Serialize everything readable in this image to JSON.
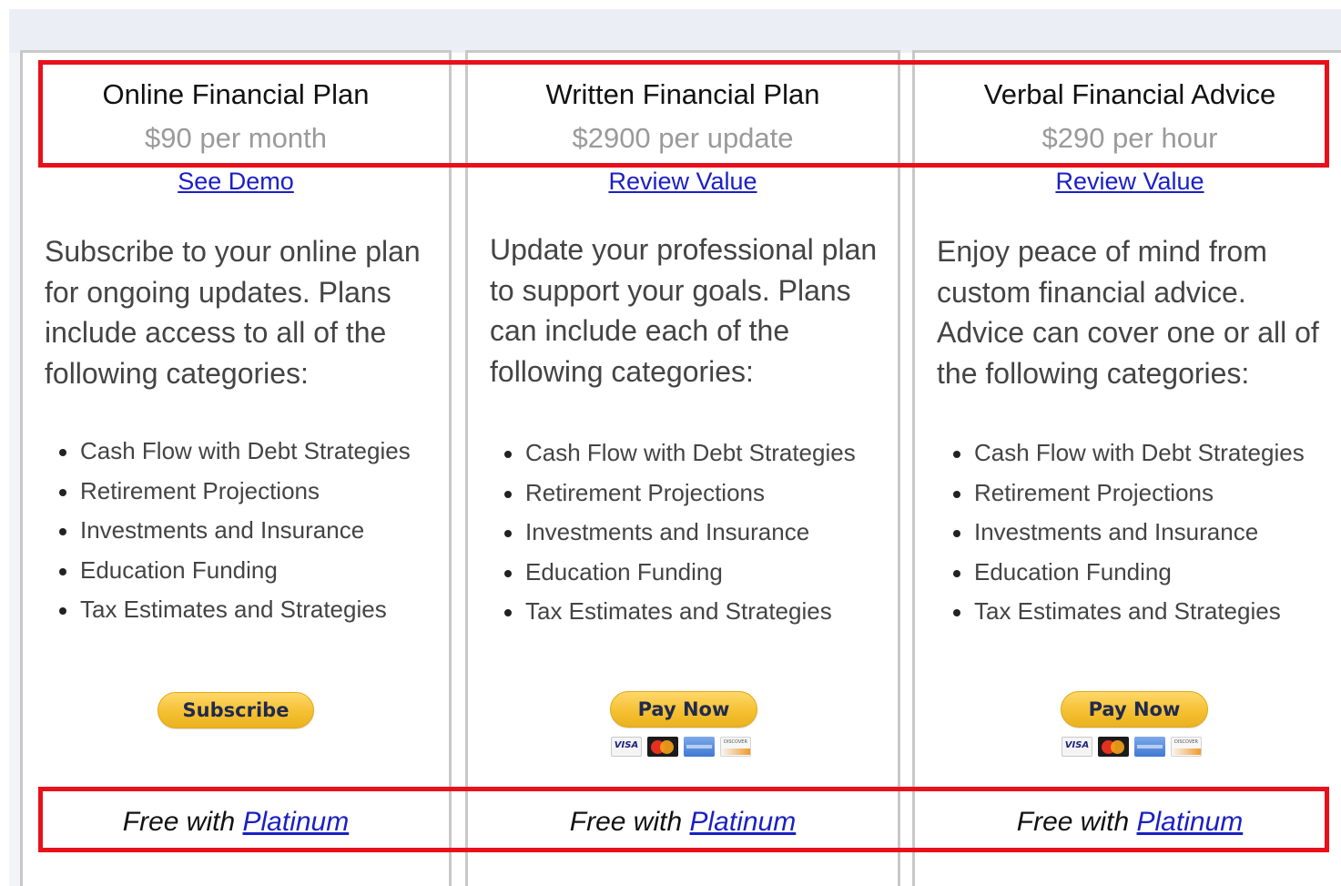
{
  "plans": [
    {
      "title": "Online Financial Plan",
      "price": "$90 per month",
      "link": "See Demo",
      "description": "Subscribe to your online plan for ongoing updates. Plans include access to all of the following categories:",
      "features": [
        "Cash Flow with Debt Strategies",
        "Retirement Projections",
        "Investments and Insurance",
        "Education Funding",
        "Tax Estimates and Strategies"
      ],
      "button": "Subscribe",
      "show_cards": false,
      "footer_prefix": "Free with ",
      "footer_link": "Platinum"
    },
    {
      "title": "Written Financial Plan",
      "price": "$2900 per update",
      "link": "Review Value",
      "description": "Update your professional plan to support your goals. Plans can include each of the following categories:",
      "features": [
        "Cash Flow with Debt Strategies",
        "Retirement Projections",
        "Investments and Insurance",
        "Education Funding",
        "Tax Estimates and Strategies"
      ],
      "button": "Pay Now",
      "show_cards": true,
      "footer_prefix": "Free with ",
      "footer_link": "Platinum"
    },
    {
      "title": "Verbal Financial Advice",
      "price": "$290 per hour",
      "link": "Review Value",
      "description": "Enjoy peace of mind from custom financial advice. Advice can cover one or all of the following categories:",
      "features": [
        "Cash Flow with Debt Strategies",
        "Retirement Projections",
        "Investments and Insurance",
        "Education Funding",
        "Tax Estimates and Strategies"
      ],
      "button": "Pay Now",
      "show_cards": true,
      "footer_prefix": "Free with ",
      "footer_link": "Platinum"
    }
  ],
  "payment_card_icons": [
    "visa-icon",
    "mastercard-icon",
    "amex-icon",
    "discover-icon"
  ],
  "payment_card_visa_text": "VISA",
  "payment_card_discover_text": "DISCOVER",
  "colors": {
    "highlight": "#e8101a",
    "link": "#1a1fc4",
    "button": "#f5c032",
    "price": "#9a9a9a"
  }
}
